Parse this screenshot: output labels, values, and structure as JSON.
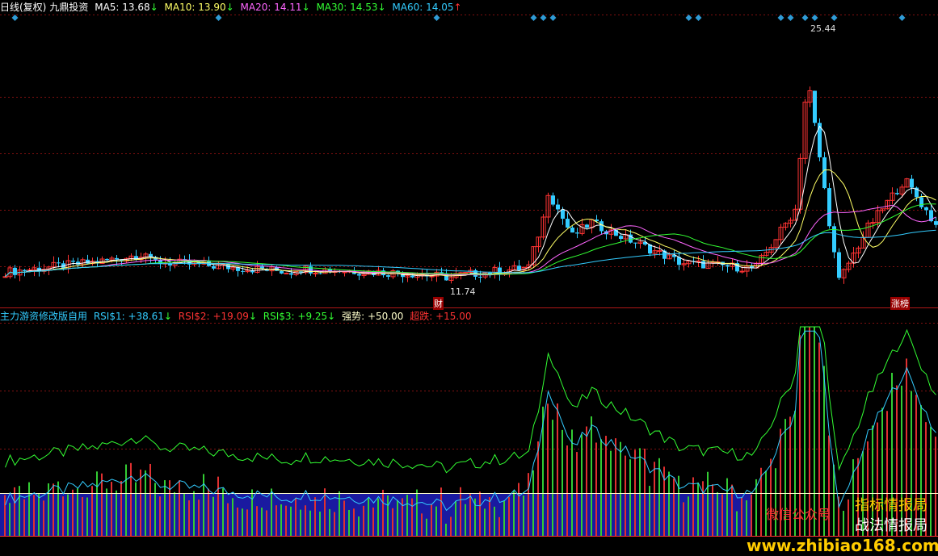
{
  "top_panel": {
    "title": "日线(复权)",
    "stock_name": "九鼎投资",
    "indicators": [
      {
        "label": "MA5:",
        "value": "13.68",
        "arrow": "↓",
        "color": "#ffffff"
      },
      {
        "label": "MA10:",
        "value": "13.90",
        "arrow": "↓",
        "color": "#ffff66"
      },
      {
        "label": "MA20:",
        "value": "14.11",
        "arrow": "↓",
        "color": "#ff66ff"
      },
      {
        "label": "MA30:",
        "value": "14.53",
        "arrow": "↓",
        "color": "#33ff33"
      },
      {
        "label": "MA60:",
        "value": "14.05",
        "arrow": "↑",
        "color": "#33ccff"
      }
    ],
    "high_label": "25.44",
    "low_label": "11.74",
    "event_marker_1": "财",
    "event_marker_2": "涨榜"
  },
  "bottom_panel": {
    "title": "主力游资修改版自用",
    "indicators": [
      {
        "label": "RSI$1:",
        "value": "+38.61",
        "arrow": "↓",
        "color": "#33ccff"
      },
      {
        "label": "RSI$2:",
        "value": "+19.09",
        "arrow": "↓",
        "color": "#ff3333"
      },
      {
        "label": "RSI$3:",
        "value": "+9.25",
        "arrow": "↓",
        "color": "#33ff33"
      },
      {
        "label": "强势:",
        "value": "+50.00",
        "arrow": "",
        "color": "#ffff99"
      },
      {
        "label": "超跌:",
        "value": "+15.00",
        "arrow": "",
        "color": "#ff3333"
      }
    ]
  },
  "watermark": {
    "line1": "微信公众号",
    "line2": "指标情报局",
    "line3": "战法情报局",
    "url": "www.zhibiao168.com"
  },
  "colors": {
    "bg": "#000000",
    "up": "#ff3333",
    "down": "#33ccff",
    "grid": "#801010",
    "diamond": "#2f9bd6",
    "ma5": "#ffffff",
    "ma10": "#ffff66",
    "ma20": "#ff66ff",
    "ma30": "#33ff33",
    "ma60": "#33ccff"
  }
}
